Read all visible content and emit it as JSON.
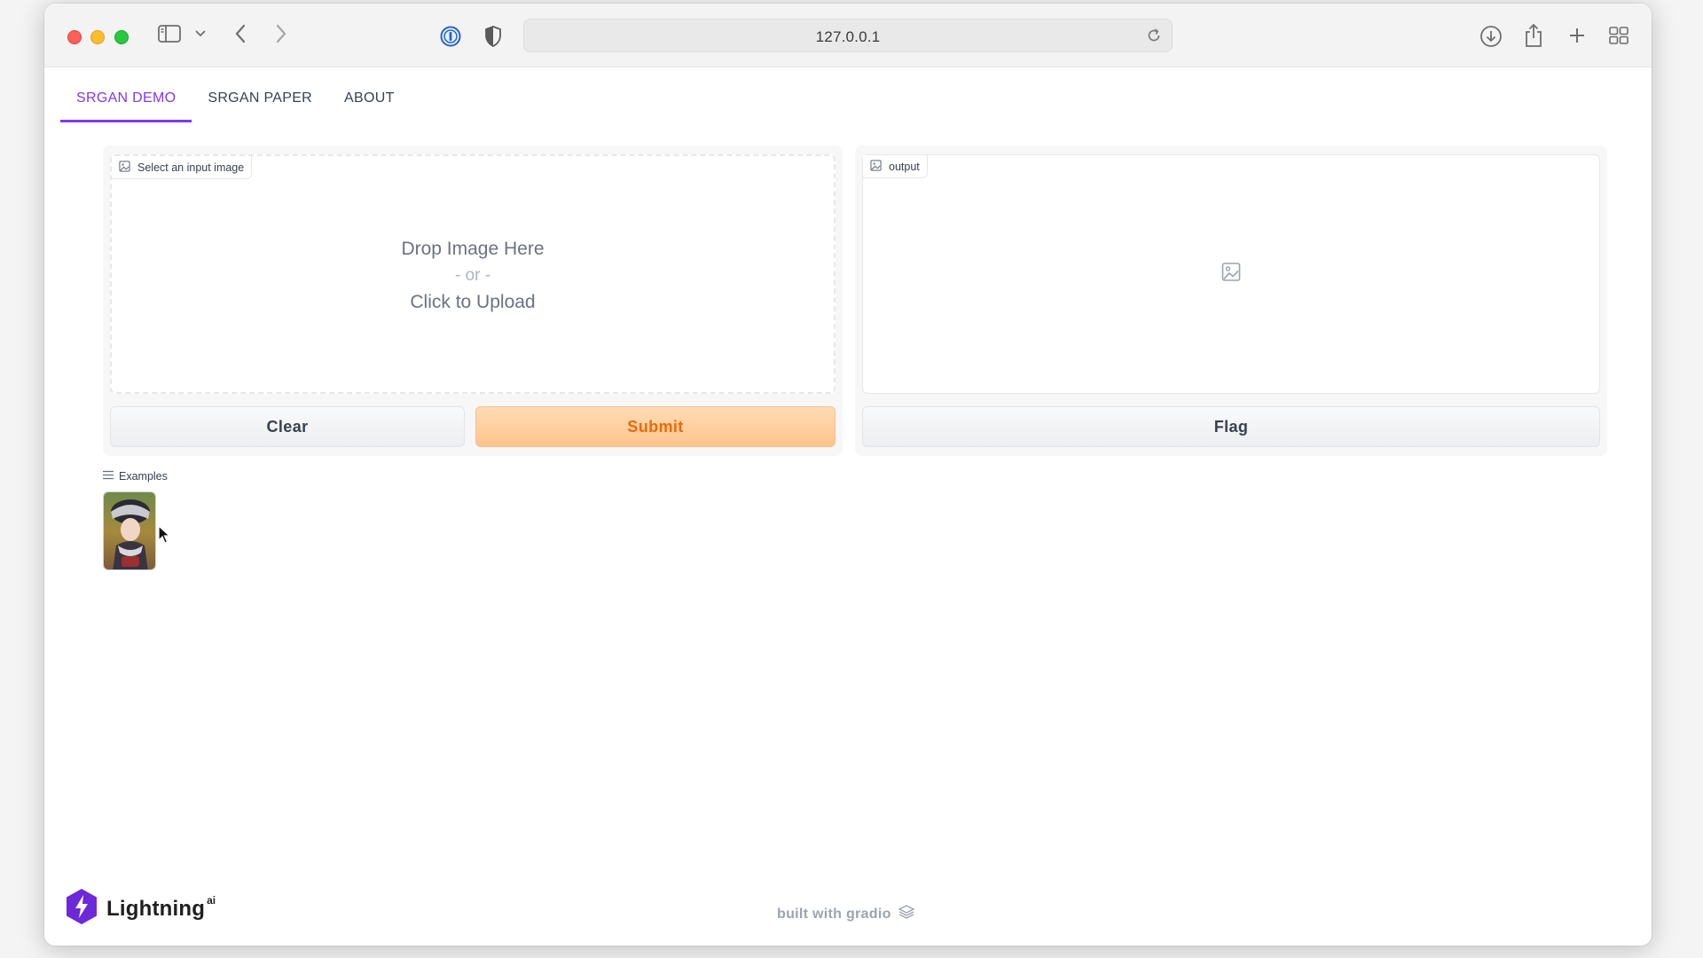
{
  "browser": {
    "url": "127.0.0.1"
  },
  "tabs": [
    {
      "label": "SRGAN DEMO",
      "active": true
    },
    {
      "label": "SRGAN PAPER",
      "active": false
    },
    {
      "label": "ABOUT",
      "active": false
    }
  ],
  "input_panel": {
    "label": "Select an input image",
    "drop_text": "Drop Image Here",
    "or_text": "- or -",
    "upload_text": "Click to Upload"
  },
  "output_panel": {
    "label": "output"
  },
  "buttons": {
    "clear": "Clear",
    "submit": "Submit",
    "flag": "Flag"
  },
  "examples": {
    "label": "Examples"
  },
  "footer": {
    "logo_text": "Lightning",
    "logo_sup": "ai",
    "built_with": "built with gradio"
  },
  "colors": {
    "accent": "#7c3aed",
    "submit_bg": "#fdc48c",
    "submit_text": "#ea6a09",
    "logo_purple": "#6d28d9"
  }
}
